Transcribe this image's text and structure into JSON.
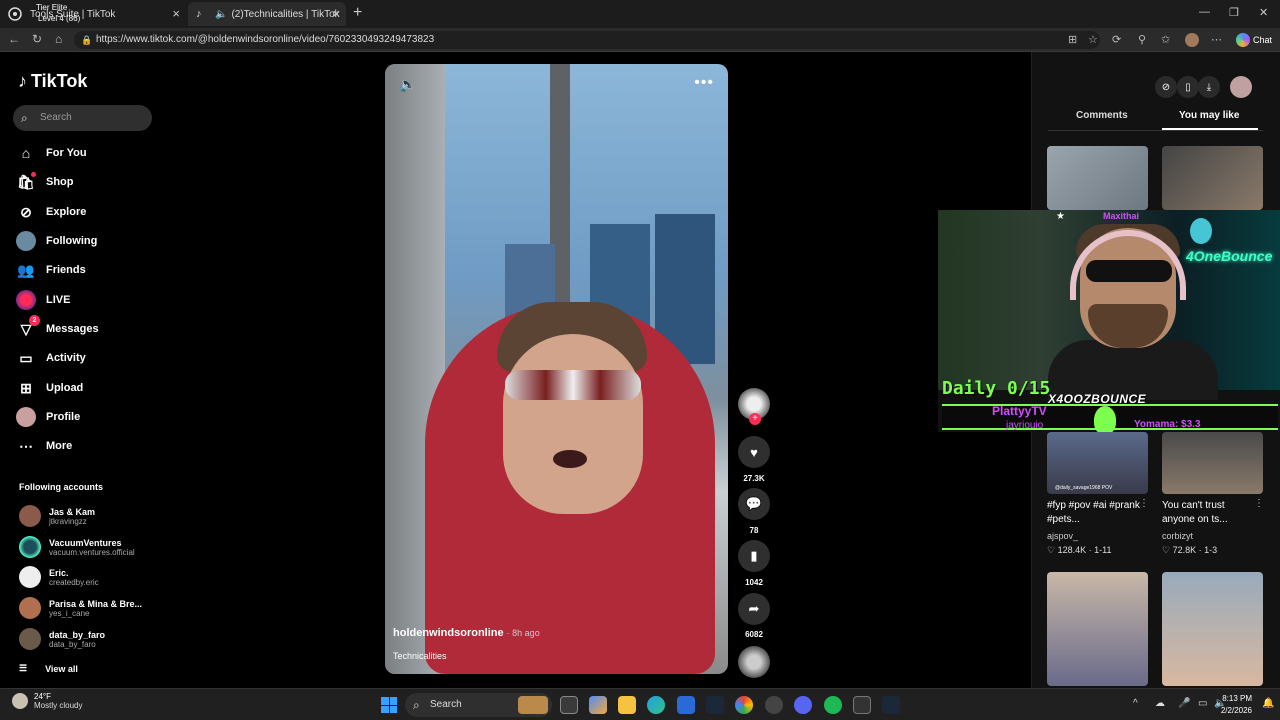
{
  "browser": {
    "tabs": [
      {
        "title": "Tools Suite | TikTok",
        "overlay_line1": "Tier Elite",
        "overlay_line2": "Level 4  (86)"
      },
      {
        "title": "(2)Technicalities | TikTok"
      }
    ],
    "url": "https://www.tiktok.com/@holdenwindsoronline/video/7602330493249473823",
    "chat_label": "Chat"
  },
  "sidebar": {
    "logo": "TikTok",
    "search_placeholder": "Search",
    "nav": [
      {
        "label": "For You",
        "icon": "home-icon"
      },
      {
        "label": "Shop",
        "icon": "shop-icon"
      },
      {
        "label": "Explore",
        "icon": "compass-icon"
      },
      {
        "label": "Following",
        "icon": "following-avatar-icon"
      },
      {
        "label": "Friends",
        "icon": "friends-icon"
      },
      {
        "label": "LIVE",
        "icon": "live-icon"
      },
      {
        "label": "Messages",
        "icon": "messages-icon",
        "badge": "2"
      },
      {
        "label": "Activity",
        "icon": "activity-icon"
      },
      {
        "label": "Upload",
        "icon": "upload-icon"
      },
      {
        "label": "Profile",
        "icon": "profile-avatar-icon"
      },
      {
        "label": "More",
        "icon": "more-icon"
      }
    ],
    "following_title": "Following accounts",
    "following": [
      {
        "name": "Jas & Kam",
        "handle": "jtkravingzz"
      },
      {
        "name": "VacuumVentures",
        "handle": "vacuum.ventures.official"
      },
      {
        "name": "Eric.",
        "handle": "createdby.eric"
      },
      {
        "name": "Parisa & Mina & Bre...",
        "handle": "yes_i_cane"
      },
      {
        "name": "data_by_faro",
        "handle": "data_by_faro"
      }
    ],
    "view_all": "View all"
  },
  "video": {
    "author": "holdenwindsoronline",
    "time_ago": "· 8h ago",
    "caption": "Technicalities",
    "likes": "27.3K",
    "comments": "78",
    "saves": "1042",
    "shares": "6082"
  },
  "right_panel": {
    "tab_comments": "Comments",
    "tab_you_may_like": "You may like",
    "cards": [
      {
        "title": "#fyp #pov #ai #prank #pets...",
        "author": "ajspov_",
        "views": "128.4K",
        "age": "1-11",
        "thumb_caption": "@daily_savage1968 POV"
      },
      {
        "title": "You can't trust anyone on ts...",
        "author": "corbizyt",
        "views": "72.8K",
        "age": "1-3"
      }
    ]
  },
  "stream_overlay": {
    "top_name": "Maxithai",
    "neon_sign": "4OneBounce",
    "daily": "Daily 0/15",
    "streamer": "X4OOZBOUNCE",
    "platty": "PlattyyTV",
    "viewer": "jayriouio",
    "donation": "Yomama: $3.3"
  },
  "taskbar": {
    "weather_temp": "24°F",
    "weather_desc": "Mostly cloudy",
    "search": "Search",
    "time": "8:13 PM",
    "date": "2/2/2026"
  }
}
